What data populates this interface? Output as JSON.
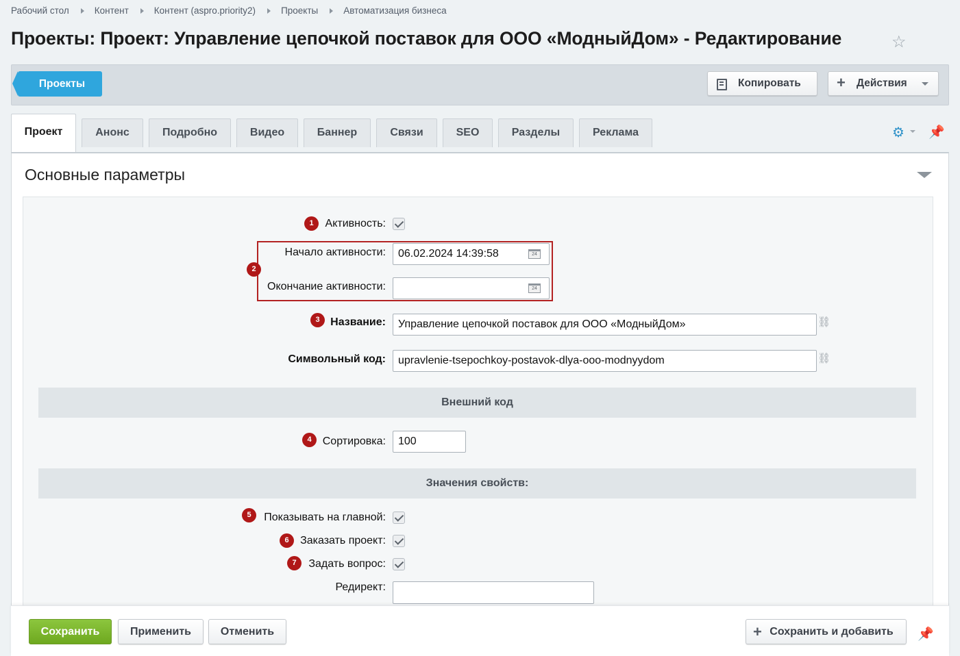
{
  "breadcrumbs": [
    "Рабочий стол",
    "Контент",
    "Контент (aspro.priority2)",
    "Проекты",
    "Автоматизация бизнеса"
  ],
  "title": "Проекты: Проект: Управление цепочкой поставок для ООО «МодныйДом» - Редактирование",
  "toolbar": {
    "back_label": "Проекты",
    "copy_label": "Копировать",
    "actions_label": "Действия"
  },
  "tabs": [
    "Проект",
    "Анонс",
    "Подробно",
    "Видео",
    "Баннер",
    "Связи",
    "SEO",
    "Разделы",
    "Реклама"
  ],
  "section_title": "Основные параметры",
  "form": {
    "active_label": "Активность:",
    "active_from_label": "Начало активности:",
    "active_from_value": "06.02.2024 14:39:58",
    "active_to_label": "Окончание активности:",
    "active_to_value": "",
    "calendar_day": "24",
    "name_label": "Название:",
    "name_value": "Управление цепочкой поставок для ООО «МодныйДом»",
    "code_label": "Символьный код:",
    "code_value": "upravlenie-tsepochkoy-postavok-dlya-ooo-modnyydom",
    "external_code_header": "Внешний код",
    "sort_label": "Сортировка:",
    "sort_value": "100",
    "properties_header": "Значения свойств:",
    "show_main_label": "Показывать на главной:",
    "order_label": "Заказать проект:",
    "ask_label": "Задать вопрос:",
    "redirect_label": "Редирект:",
    "redirect_value": ""
  },
  "badges": [
    "1",
    "2",
    "3",
    "4",
    "5",
    "6",
    "7"
  ],
  "footer": {
    "save_label": "Сохранить",
    "apply_label": "Применить",
    "cancel_label": "Отменить",
    "save_add_label": "Сохранить и добавить"
  },
  "colors": {
    "accent_blue": "#2fa6dd",
    "save_green": "#7ab52c",
    "badge_red": "#b01818"
  }
}
